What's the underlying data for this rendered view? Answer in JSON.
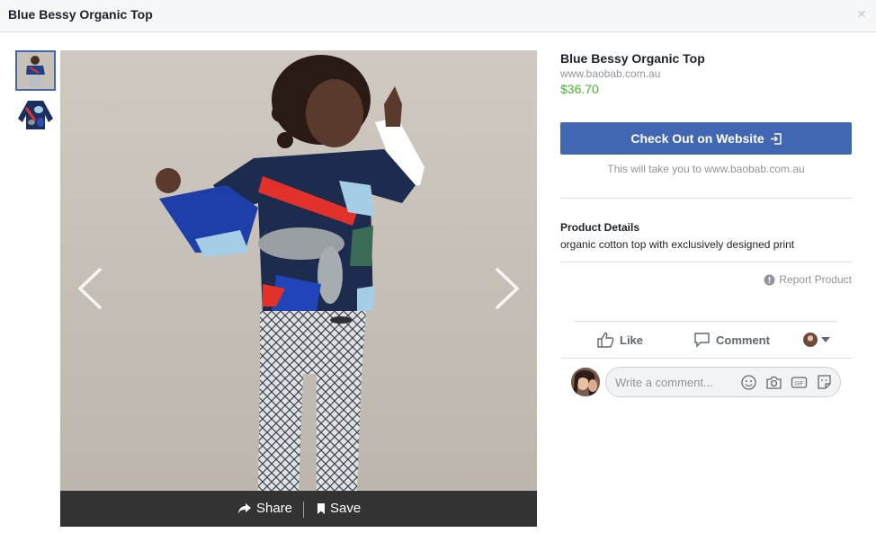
{
  "header": {
    "title": "Blue Bessy Organic Top",
    "close_glyph": "×"
  },
  "gallery": {
    "thumbnails": [
      {
        "icon": "child-photo-thumbnail",
        "selected": true
      },
      {
        "icon": "top-garment-thumbnail",
        "selected": false
      }
    ]
  },
  "image_bar": {
    "share_label": "Share",
    "save_label": "Save"
  },
  "product": {
    "title": "Blue Bessy Organic Top",
    "domain": "www.baobab.com.au",
    "price": "$36.70",
    "price_color": "#42b72a"
  },
  "checkout": {
    "label": "Check Out on Website",
    "note": "This will take you to www.baobab.com.au",
    "color": "#4267b2"
  },
  "details": {
    "heading": "Product Details",
    "text": "organic cotton top with exclusively designed print"
  },
  "report": {
    "label": "Report Product"
  },
  "actions": {
    "like_label": "Like",
    "comment_label": "Comment"
  },
  "comment": {
    "placeholder": "Write a comment..."
  }
}
